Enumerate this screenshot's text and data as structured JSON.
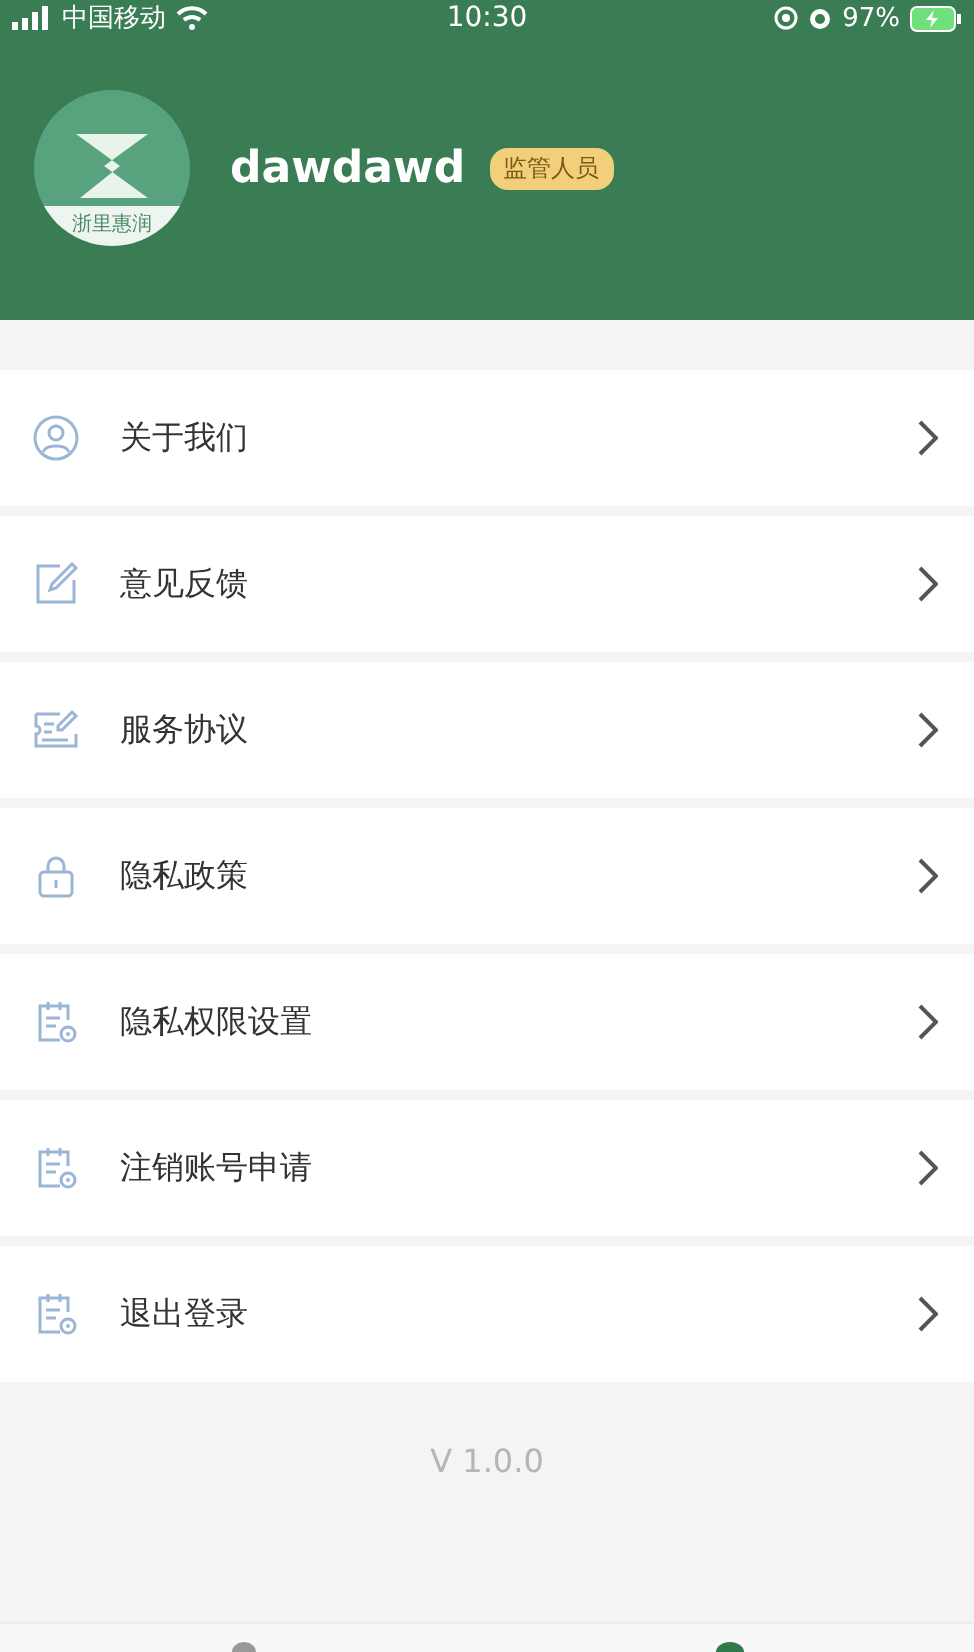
{
  "status_bar": {
    "carrier": "中国移动",
    "time": "10:30",
    "battery": "97%"
  },
  "profile": {
    "name": "dawdawd",
    "role": "监管人员",
    "logo_text": "浙里惠润"
  },
  "menu": [
    {
      "label": "关于我们",
      "kind": "person"
    },
    {
      "label": "意见反馈",
      "kind": "edit"
    },
    {
      "label": "服务协议",
      "kind": "sign"
    },
    {
      "label": "隐私政策",
      "kind": "lock"
    },
    {
      "label": "隐私权限设置",
      "kind": "doc"
    },
    {
      "label": "注销账号申请",
      "kind": "doc"
    },
    {
      "label": "退出登录",
      "kind": "doc"
    }
  ],
  "version": "V 1.0.0",
  "tab_bar": [
    {
      "selected": false
    },
    {
      "selected": true
    }
  ]
}
